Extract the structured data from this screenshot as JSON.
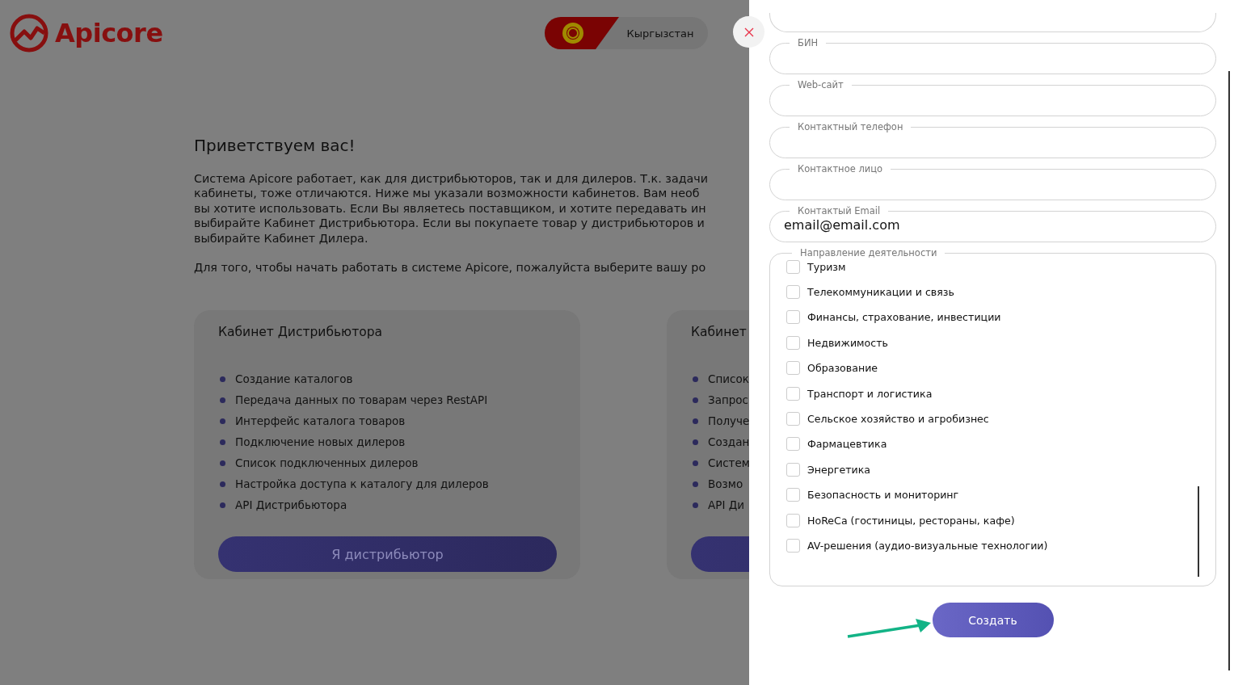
{
  "header": {
    "logo": "Apicore",
    "country": "Кыргызстан"
  },
  "welcome": {
    "title": "Приветствуем вас!",
    "lines": [
      "Система Apicore работает, как для дистрибьюторов, так и для дилеров. Т.к. задачи",
      "кабинеты, тоже отличаются. Ниже мы указали возможности кабинетов. Вам необ",
      "вы хотите использовать. Если Вы являетесь поставщиком, и хотите передавать ин",
      "выбирайте Кабинет Дистрибьютора. Если вы покупаете товар у дистрибьюторов и",
      "выбирайте Кабинет Дилера."
    ],
    "prompt": "Для того, чтобы начать работать в системе Apicore, пожалуйста выберите вашу ро"
  },
  "cabinets": [
    {
      "title": "Кабинет Дистрибьютора",
      "features": [
        "Создание каталогов",
        "Передача данных по товарам через RestAPI",
        "Интерфейс каталога товаров",
        "Подключение новых дилеров",
        "Список подключенных дилеров",
        "Настройка доступа к каталогу для дилеров",
        "API Дистрибьютора"
      ],
      "button": "Я дистрибьютор"
    },
    {
      "title": "Кабинет",
      "features": [
        "Список",
        "Запрос",
        "Получе",
        "Создан",
        "Систем",
        "Возмо",
        "API Ди"
      ]
    }
  ],
  "drawer": {
    "fields": [
      {
        "kind": "partial"
      },
      {
        "kind": "text",
        "label": "БИН"
      },
      {
        "kind": "text",
        "label": "Web-сайт"
      },
      {
        "kind": "text",
        "label": "Контактный телефон"
      },
      {
        "kind": "text",
        "label": "Контактное лицо"
      },
      {
        "kind": "text",
        "label": "Контактый Email",
        "value": "email@email.com"
      }
    ],
    "activity": {
      "legend": "Направление деятельности",
      "options": [
        {
          "label": "Туризм",
          "checked": false
        },
        {
          "label": "Телекоммуникации и связь",
          "checked": false
        },
        {
          "label": "Финансы, страхование, инвестиции",
          "checked": false
        },
        {
          "label": "Недвижимость",
          "checked": false
        },
        {
          "label": "Образование",
          "checked": false
        },
        {
          "label": "Транспорт и логистика",
          "checked": false
        },
        {
          "label": "Сельское хозяйство и агробизнес",
          "checked": false
        },
        {
          "label": "Фармацевтика",
          "checked": false
        },
        {
          "label": "Энергетика",
          "checked": false
        },
        {
          "label": "Безопасность и мониторинг",
          "checked": false
        },
        {
          "label": "HoReCa (гостиницы, рестораны, кафе)",
          "checked": false
        },
        {
          "label": "AV-решения (аудио-визуальные технологии)",
          "checked": false
        }
      ]
    },
    "submit": "Создать"
  }
}
